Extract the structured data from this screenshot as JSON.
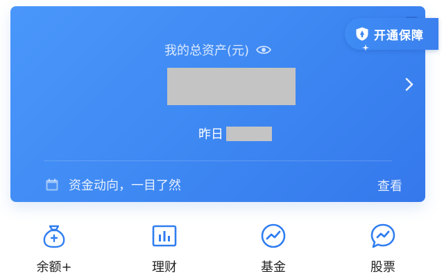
{
  "badge": {
    "label": "开通保障",
    "icon": "shield-icon"
  },
  "asset": {
    "title": "我的总资产(元)",
    "eye_icon": "eye-icon",
    "value_masked": true
  },
  "yesterday": {
    "label": "昨日"
  },
  "flow": {
    "label": "资金动向，一目了然",
    "icon": "calendar-icon",
    "action": "查看"
  },
  "nav": [
    {
      "label": "余额+",
      "icon": "money-bag-icon"
    },
    {
      "label": "理财",
      "icon": "bar-chart-icon"
    },
    {
      "label": "基金",
      "icon": "trend-circle-icon"
    },
    {
      "label": "股票",
      "icon": "chat-trend-icon"
    }
  ],
  "colors": {
    "card": "#3d87f2",
    "accent": "#2f6fd8",
    "text_white": "#ffffff",
    "nav_text": "#222222"
  }
}
